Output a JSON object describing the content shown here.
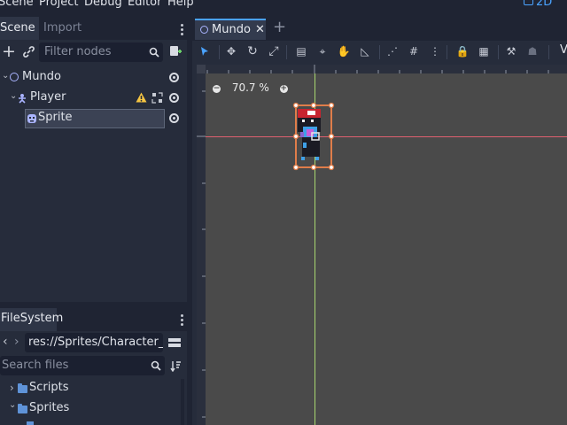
{
  "menu": {
    "items": [
      "Scene",
      "Project",
      "Debug",
      "Editor",
      "Help"
    ],
    "mode_label": "2D"
  },
  "scene_dock": {
    "tabs": {
      "scene": "Scene",
      "import": "Import"
    },
    "filter_placeholder": "Filter nodes",
    "tree": [
      {
        "label": "Mundo",
        "icon": "node2d-icon"
      },
      {
        "label": "Player",
        "icon": "kinematic-body-icon",
        "warning": true
      },
      {
        "label": "Sprite",
        "icon": "sprite-icon",
        "selected": true
      }
    ]
  },
  "filesystem_dock": {
    "tab": "FileSystem",
    "path": "res://Sprites/Character_Idl",
    "search_placeholder": "Search files",
    "items": [
      {
        "label": "Scripts",
        "icon": "folder-icon",
        "expanded": false
      },
      {
        "label": "Sprites",
        "icon": "folder-icon",
        "expanded": true
      }
    ]
  },
  "editor": {
    "scene_tab": "Mundo",
    "zoom": "70.7 %",
    "toolbar_overflow": "V"
  },
  "colors": {
    "accent": "#4aa3ff",
    "selection": "#e07d4a",
    "x_axis": "#e06070",
    "y_axis": "#a8d870",
    "viewport_bg": "#4a4a4a"
  }
}
